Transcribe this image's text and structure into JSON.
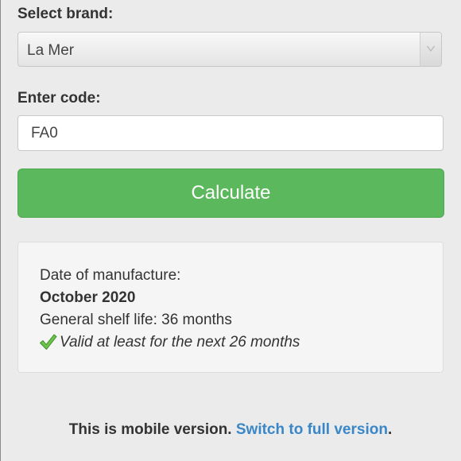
{
  "brand": {
    "label": "Select brand:",
    "selected": "La Mer"
  },
  "code": {
    "label": "Enter code:",
    "value": "FA0"
  },
  "calculate_label": "Calculate",
  "result": {
    "manufacture_label": "Date of manufacture:",
    "manufacture_date": "October 2020",
    "shelf_life": "General shelf life: 36 months",
    "validity": "Valid at least for the next 26 months"
  },
  "footer": {
    "text": "This is mobile version.",
    "link": "Switch to full version",
    "end": "."
  },
  "colors": {
    "button": "#5cb85c",
    "link": "#3a87c8",
    "check": "#5cb85c"
  },
  "icons": {
    "select_arrow": "chevron-down-icon",
    "valid": "checkmark-icon"
  }
}
